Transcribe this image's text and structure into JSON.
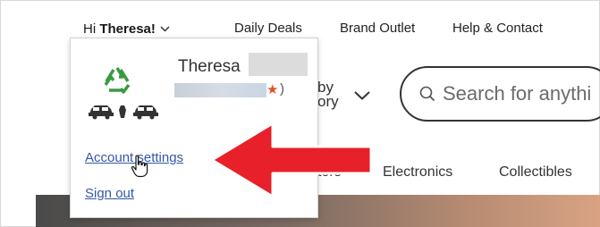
{
  "nav": {
    "greeting_prefix": "Hi ",
    "greeting_name": "Theresa!",
    "links": [
      "Daily Deals",
      "Brand Outlet",
      "Help & Contact"
    ]
  },
  "dropdown": {
    "user_name": "Theresa",
    "rating_suffix": ")",
    "account_settings": "Account settings",
    "sign_out": "Sign out"
  },
  "page": {
    "by_category_line1": "by",
    "by_category_line2": "ory",
    "search_placeholder": "Search for anythi",
    "categories": [
      "tors",
      "Electronics",
      "Collectibles"
    ]
  },
  "colors": {
    "link": "#3457a8",
    "arrow": "#e8202a",
    "recycle": "#3a9a3f"
  }
}
